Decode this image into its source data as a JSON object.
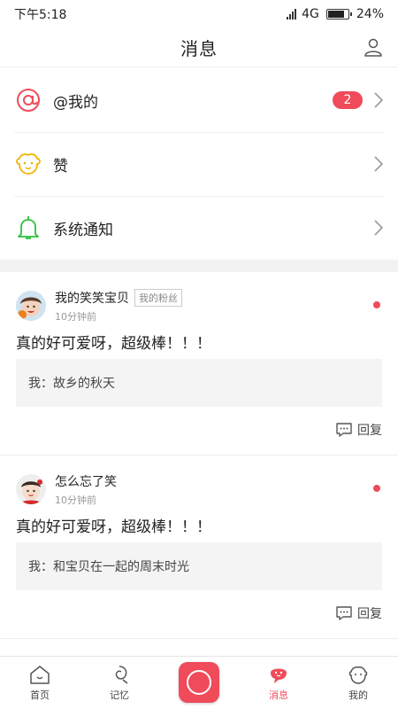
{
  "status_bar": {
    "time": "下午5:18",
    "network": "4G",
    "battery": "24%",
    "battery_level": 0.85
  },
  "header": {
    "title": "消息"
  },
  "categories": [
    {
      "label": "@我的",
      "icon": "at-icon",
      "badge": "2"
    },
    {
      "label": "赞",
      "icon": "baby-face-icon"
    },
    {
      "label": "系统通知",
      "icon": "bell-icon"
    }
  ],
  "messages": [
    {
      "name": "我的笑笑宝贝",
      "tag": "我的粉丝",
      "time_ago": "10分钟前",
      "text": "真的好可爱呀，超级棒！！！",
      "quote": "我：故乡的秋天",
      "reply_label": "回复"
    },
    {
      "name": "怎么忘了笑",
      "time_ago": "10分钟前",
      "text": "真的好可爱呀，超级棒！！！",
      "quote": "我：和宝贝在一起的周末时光",
      "reply_label": "回复"
    }
  ],
  "bottom_nav": [
    {
      "label": "首页",
      "icon": "home-icon"
    },
    {
      "label": "记忆",
      "icon": "memory-icon"
    },
    {
      "label": "",
      "icon": "camera-icon"
    },
    {
      "label": "消息",
      "icon": "message-icon",
      "active": true
    },
    {
      "label": "我的",
      "icon": "mine-icon"
    }
  ],
  "colors": {
    "accent": "#f04b5a",
    "at_icon": "#f04b5a",
    "like_icon": "#f0b400",
    "bell_icon": "#2dbf3a"
  }
}
